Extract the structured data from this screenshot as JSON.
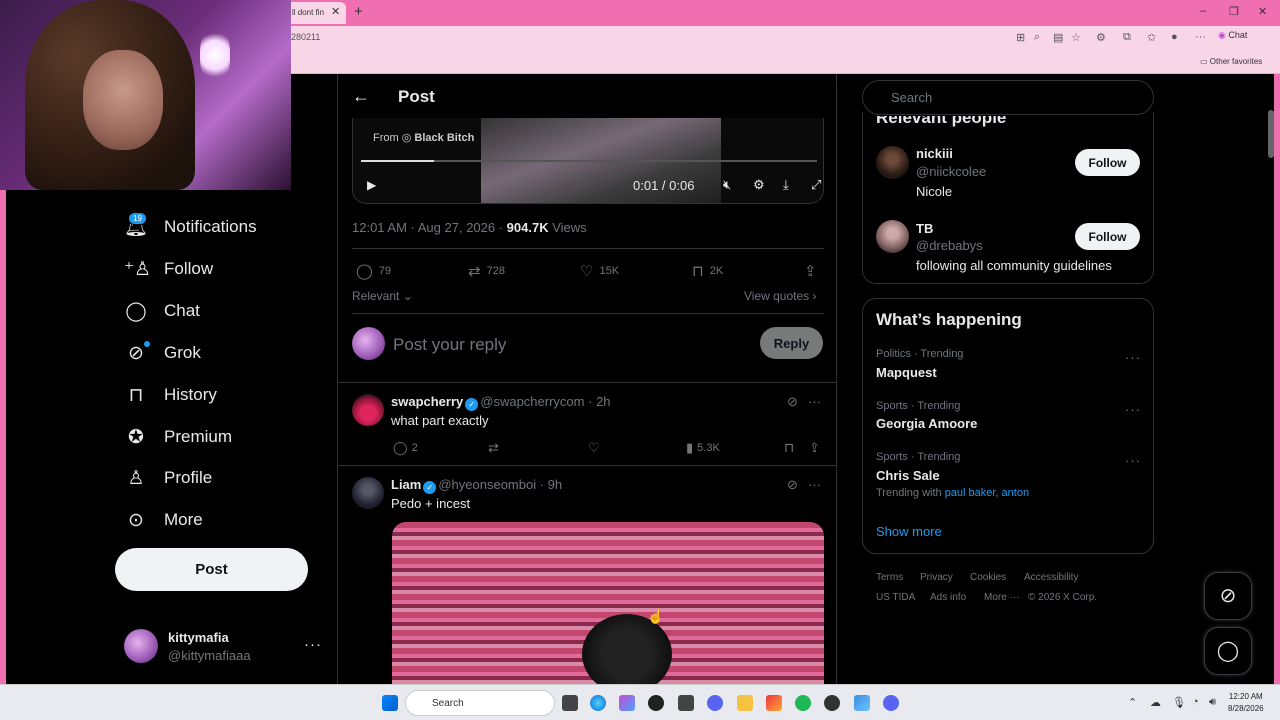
{
  "browser": {
    "tab_title": "ll dont fin",
    "tab_close": "✕",
    "tab_new": "+",
    "address": "280211",
    "chat_label": "Chat",
    "other_favorites": "Other favorites",
    "window_controls": [
      "–",
      "❐",
      "✕"
    ]
  },
  "sidebar": {
    "notifications_badge": "19",
    "items": [
      {
        "label": "Notifications",
        "icon": "bell-icon"
      },
      {
        "label": "Follow",
        "icon": "person-plus-icon"
      },
      {
        "label": "Chat",
        "icon": "chat-bubble-icon"
      },
      {
        "label": "Grok",
        "icon": "grok-icon"
      },
      {
        "label": "History",
        "icon": "bookmark-icon"
      },
      {
        "label": "Premium",
        "icon": "verified-badge-icon"
      },
      {
        "label": "Profile",
        "icon": "person-icon"
      },
      {
        "label": "More",
        "icon": "more-circle-icon"
      }
    ],
    "post_button": "Post",
    "account": {
      "name": "kittymafia",
      "handle": "@kittymafiaaa",
      "more": "···"
    }
  },
  "post": {
    "header_title": "Post",
    "video": {
      "from_prefix": "From",
      "from_name": "Black Bitch",
      "time": "0:01 / 0:06",
      "progress": 0.16
    },
    "meta": {
      "time": "12:01 AM · Aug 27, 2026 · ",
      "views_count": "904.7K",
      "views_label": " Views"
    },
    "actions": {
      "replies": "79",
      "reposts": "728",
      "likes": "15K",
      "bookmarks": "2K"
    },
    "sort_label": "Relevant",
    "view_quotes": "View quotes",
    "reply_placeholder": "Post your reply",
    "reply_button": "Reply"
  },
  "replies": [
    {
      "name": "swapcherry",
      "handle": "@swapcherrycom",
      "time": "· 2h",
      "text": "what part exactly",
      "replies": "2",
      "views": "5.3K"
    },
    {
      "name": "Liam",
      "handle": "@hyeonseomboi",
      "time": "· 9h",
      "text": "Pedo + incest"
    }
  ],
  "right": {
    "search_placeholder": "Search",
    "relevant_title": "Relevant people",
    "people": [
      {
        "name": "nickiii",
        "handle": "@niickcolee",
        "bio": "Nicole",
        "button": "Follow"
      },
      {
        "name": "TB",
        "handle": "@drebabys",
        "bio": "following all community guidelines",
        "button": "Follow"
      }
    ],
    "happening_title": "What’s happening",
    "trends": [
      {
        "category": "Politics · Trending",
        "name": "Mapquest"
      },
      {
        "category": "Sports · Trending",
        "name": "Georgia Amoore"
      },
      {
        "category": "Sports · Trending",
        "name": "Chris Sale",
        "with_prefix": "Trending with",
        "with_links": "paul baker, anton"
      }
    ],
    "show_more": "Show more",
    "footer": [
      "Terms",
      "Privacy",
      "Cookies",
      "Accessibility",
      "US TIDA",
      "Ads info",
      "More ···",
      "© 2026 X Corp."
    ]
  },
  "taskbar": {
    "search_label": "Search",
    "time": "12:20 AM",
    "date": "8/28/2026"
  },
  "colors": {
    "accent": "#1d9bf0",
    "browser_pink": "#f06fb0",
    "background": "#000000"
  }
}
